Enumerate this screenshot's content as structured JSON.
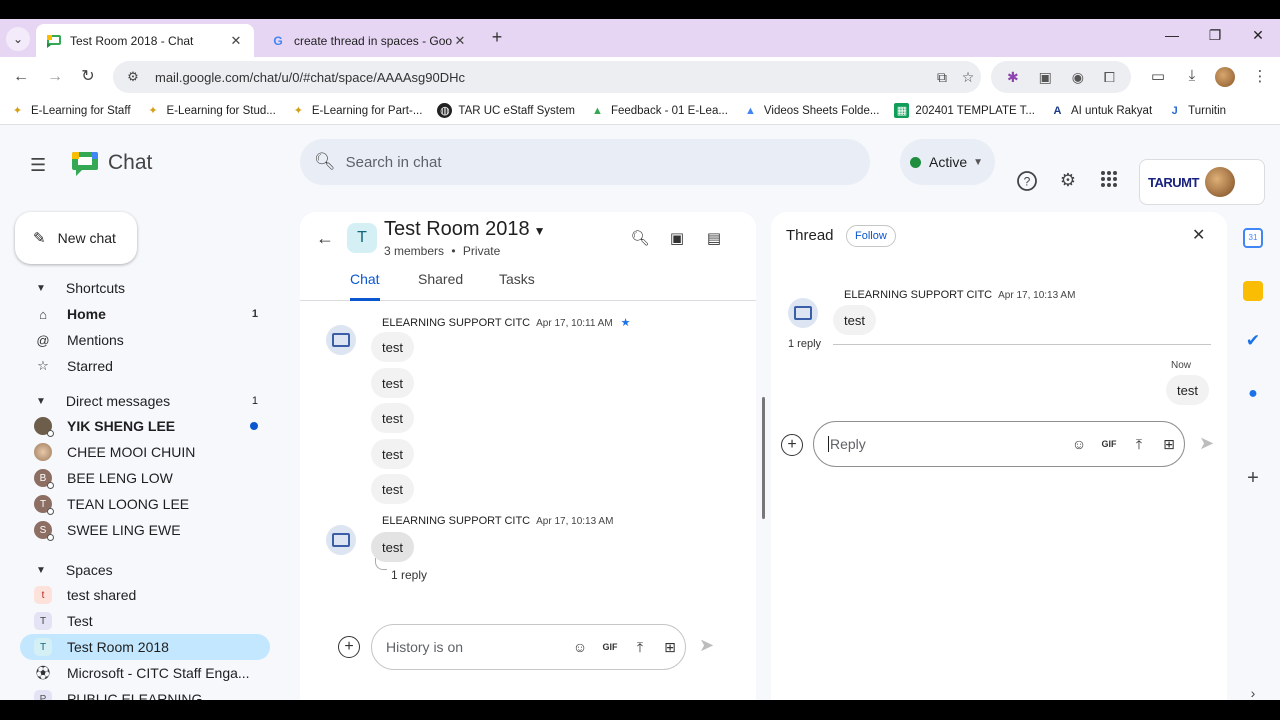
{
  "browser": {
    "tabs": [
      {
        "title": "Test Room 2018 - Chat",
        "active": true
      },
      {
        "title": "create thread in spaces - Googl",
        "active": false
      }
    ],
    "url": "mail.google.com/chat/u/0/#chat/space/AAAAsg90DHc",
    "bookmarks": [
      {
        "label": "E-Learning for Staff"
      },
      {
        "label": "E-Learning for Stud..."
      },
      {
        "label": "E-Learning for Part-..."
      },
      {
        "label": "TAR UC eStaff System"
      },
      {
        "label": "Feedback - 01 E-Lea..."
      },
      {
        "label": "Videos Sheets Folde..."
      },
      {
        "label": "202401 TEMPLATE T..."
      },
      {
        "label": "AI untuk Rakyat"
      },
      {
        "label": "Turnitin"
      }
    ]
  },
  "app": {
    "name": "Chat",
    "search_placeholder": "Search in chat",
    "status": "Active",
    "org_label": "TARUMT",
    "new_chat_label": "New chat"
  },
  "sidebar": {
    "shortcuts_label": "Shortcuts",
    "shortcuts": [
      {
        "label": "Home",
        "badge": "1"
      },
      {
        "label": "Mentions"
      },
      {
        "label": "Starred"
      }
    ],
    "dm_label": "Direct messages",
    "dm_badge": "1",
    "dms": [
      {
        "label": "YIK SHENG LEE",
        "initial": "Y"
      },
      {
        "label": "CHEE MOOI CHUIN",
        "initial": "C"
      },
      {
        "label": "BEE LENG LOW",
        "initial": "B"
      },
      {
        "label": "TEAN LOONG LEE",
        "initial": "T"
      },
      {
        "label": "SWEE LING EWE",
        "initial": "S"
      }
    ],
    "spaces_label": "Spaces",
    "spaces": [
      {
        "label": "test shared",
        "initial": "t"
      },
      {
        "label": "Test",
        "initial": "T"
      },
      {
        "label": "Test Room 2018",
        "initial": "T"
      },
      {
        "label": "Microsoft - CITC Staff Enga..."
      },
      {
        "label": "PUBLIC ELEARNING",
        "initial": "P"
      }
    ]
  },
  "room": {
    "initial": "T",
    "name": "Test Room 2018",
    "members": "3 members",
    "privacy": "Private",
    "tabs": [
      "Chat",
      "Shared",
      "Tasks"
    ],
    "messages": [
      {
        "sender": "ELEARNING SUPPORT CITC",
        "time": "Apr 17, 10:11 AM",
        "bubbles": [
          "test",
          "test",
          "test",
          "test",
          "test"
        ]
      },
      {
        "sender": "ELEARNING SUPPORT CITC",
        "time": "Apr 17, 10:13 AM",
        "bubbles": [
          "test"
        ],
        "replies": "1 reply"
      }
    ],
    "composer_placeholder": "History is on"
  },
  "thread": {
    "title": "Thread",
    "follow_label": "Follow",
    "sender": "ELEARNING SUPPORT CITC",
    "time": "Apr 17, 10:13 AM",
    "message": "test",
    "reply_count": "1 reply",
    "reply_time": "Now",
    "reply_message": "test",
    "composer_placeholder": "Reply"
  }
}
